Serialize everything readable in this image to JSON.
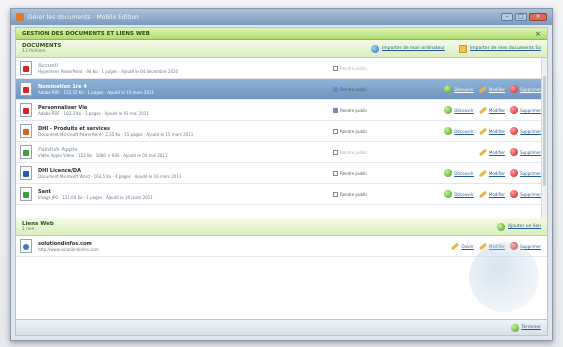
{
  "window": {
    "title": "Gérer les documents - Mobile Edition"
  },
  "panel": {
    "title": "GESTION DES DOCUMENTS ET LIENS WEB"
  },
  "documents": {
    "title": "DOCUMENTS",
    "count": "13 fichiers",
    "import_android": "Importer de mon ordinateur",
    "import_docs": "Importer de mes documents Sa",
    "items": [
      {
        "name": "Accueil",
        "meta": "Hyperliens PowerPoint · 94 Ko · 1 pages · Ajouté le 04 décembre 2010",
        "icon": "pdf-file-icon",
        "public": "Rendre public",
        "public_checked": false,
        "dim": true,
        "selected": false,
        "actions": []
      },
      {
        "name": "Nomination 1re 4",
        "meta": "Adobe PDF · 152,52 Ko · 1 pages · Ajouté le 10 mars 2011",
        "icon": "pdf-file-icon",
        "public": "Rendre public",
        "public_checked": true,
        "dim": false,
        "selected": true,
        "actions": [
          "Découvrir",
          "Modifier",
          "Supprimer"
        ]
      },
      {
        "name": "Personnaliser Vie",
        "meta": "Adobe PDF · 183,3 Ko · 1 pages · Ajouté le 01 mai 2011",
        "icon": "pdf-file-icon",
        "public": "Rendre public",
        "public_checked": true,
        "dim": false,
        "selected": false,
        "actions": [
          "Découvrir",
          "Modifier",
          "Supprimer"
        ]
      },
      {
        "name": "DHI - Produits et services",
        "meta": "Document Microsoft PowerPoint · 2,35 Ko · 15 pages · Ajouté le 15 mars 2011",
        "icon": "ppt-file-icon",
        "public": "Rendre public",
        "public_checked": false,
        "dim": false,
        "selected": false,
        "actions": [
          "Découvrir",
          "Modifier",
          "Supprimer"
        ]
      },
      {
        "name": "Fakdish Apple",
        "meta": "Vidéo Apple Video · 152 Ko · 1080 × 640 · Ajouté le 04 mai 2011",
        "icon": "img-file-icon",
        "public": "Rendre public",
        "public_checked": false,
        "dim": true,
        "selected": false,
        "actions": [
          "Modifier",
          "Supprimer"
        ]
      },
      {
        "name": "DHI Licence/DA",
        "meta": "Document Microsoft Word · 163,5 Ko · 4 pages · Ajouté le 16 mars 2011",
        "icon": "word-file-icon",
        "public": "Rendre public",
        "public_checked": false,
        "dim": false,
        "selected": false,
        "actions": [
          "Découvrir",
          "Modifier",
          "Supprimer"
        ]
      },
      {
        "name": "Sant",
        "meta": "Image JPG · 121,64 Ko · 1 pages · Ajouté le 16 mars 2011",
        "icon": "img-file-icon",
        "public": "Rendre public",
        "public_checked": false,
        "dim": false,
        "selected": false,
        "actions": [
          "Découvrir",
          "Modifier",
          "Supprimer"
        ]
      }
    ]
  },
  "links": {
    "title": "Liens Web",
    "count": "1 lien",
    "add_label": "Ajouter un lien",
    "items": [
      {
        "name": "solutiondinfos.com",
        "url": "http://www.solutiondinfos.com",
        "actions": [
          "Ouvrir",
          "Modifier",
          "Supprimer"
        ]
      }
    ]
  },
  "footer": {
    "close_label": "Terminer"
  },
  "colors": {
    "accent": "#aedc6a",
    "selection": "#7a9fc8",
    "link": "#245a96",
    "danger": "#c81c1c"
  }
}
